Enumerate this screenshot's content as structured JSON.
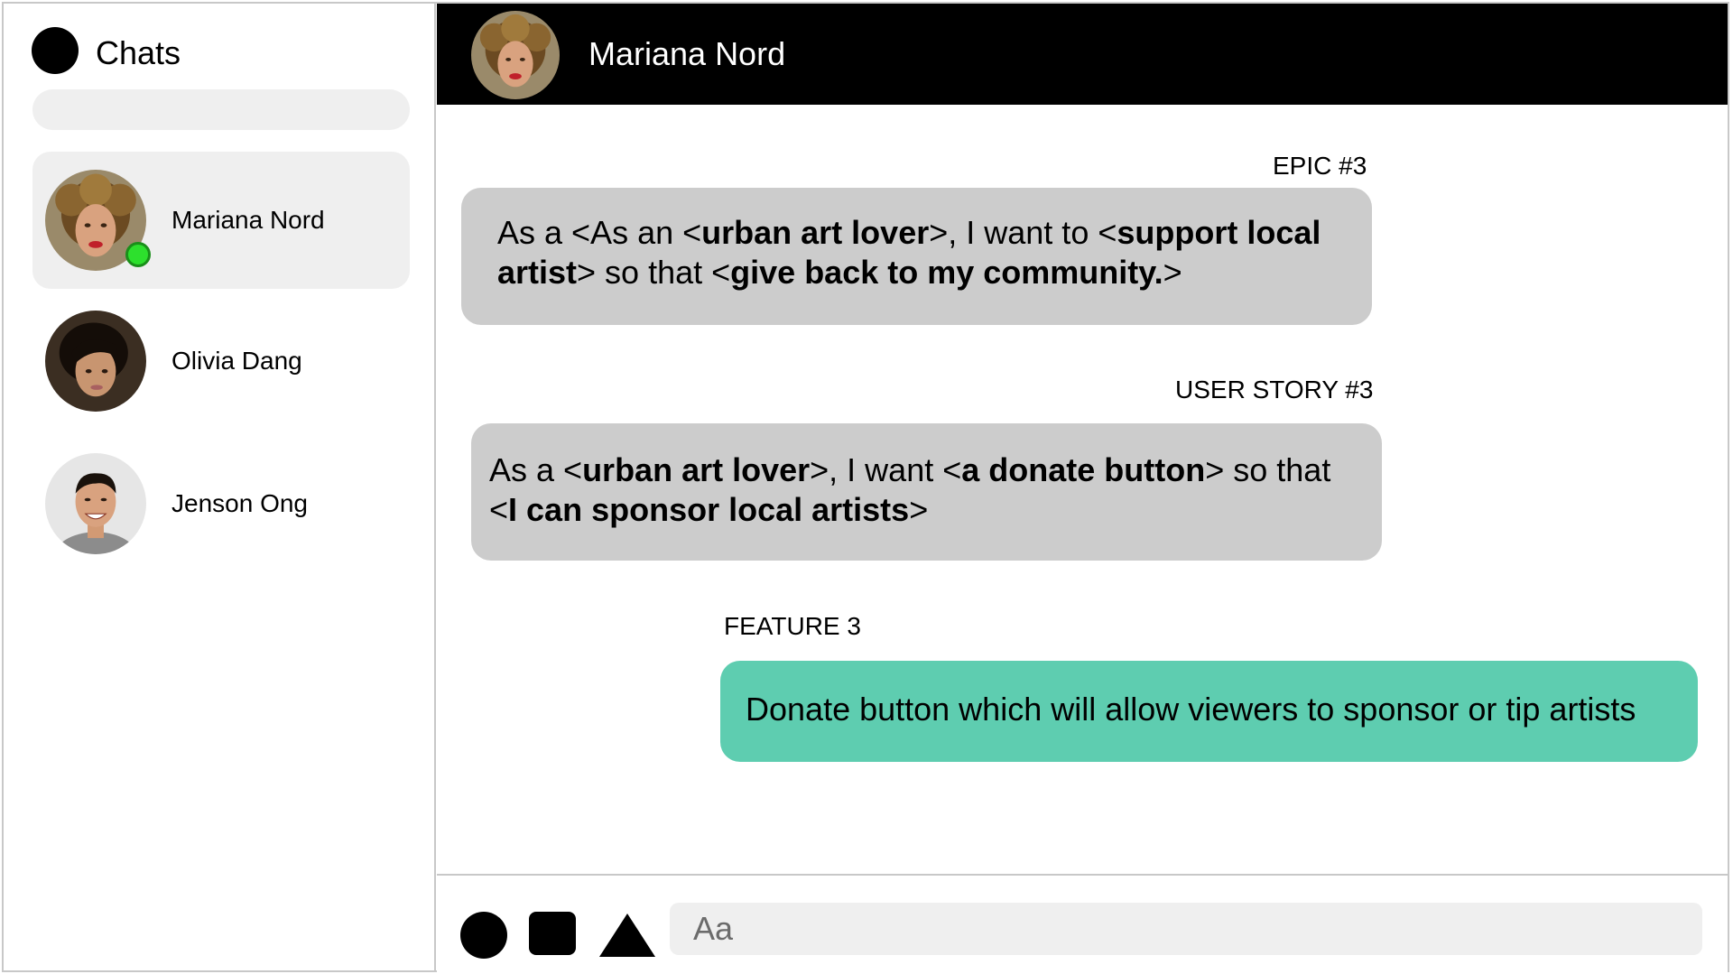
{
  "sidebar": {
    "title": "Chats",
    "search_placeholder": "",
    "chats": [
      {
        "name": "Mariana Nord",
        "active": true,
        "online": true
      },
      {
        "name": "Olivia Dang",
        "active": false,
        "online": false
      },
      {
        "name": "Jenson Ong",
        "active": false,
        "online": false
      }
    ]
  },
  "header": {
    "name": "Mariana Nord"
  },
  "messages": [
    {
      "label": "EPIC #3",
      "style": "grey",
      "parts": [
        "As a <As an <",
        "urban art lover",
        ">, I want to <",
        "support local artist",
        "> so that <",
        "give back to my community.",
        ">"
      ]
    },
    {
      "label": "USER STORY #3",
      "style": "grey",
      "parts": [
        "As a <",
        "urban art lover",
        ">, I want <",
        "a donate button",
        "> so that <",
        "I can sponsor local artists",
        ">"
      ]
    },
    {
      "label": "FEATURE 3",
      "style": "green",
      "text": "Donate button which will allow viewers to sponsor or tip artists"
    }
  ],
  "composer": {
    "placeholder": "Aa",
    "tools": [
      "circle-icon",
      "square-icon",
      "triangle-icon"
    ]
  },
  "colors": {
    "header_bg": "#000000",
    "bubble_grey": "#cccccc",
    "bubble_green": "#5ecdb0",
    "online": "#2de02d",
    "panel_light": "#efefef"
  }
}
